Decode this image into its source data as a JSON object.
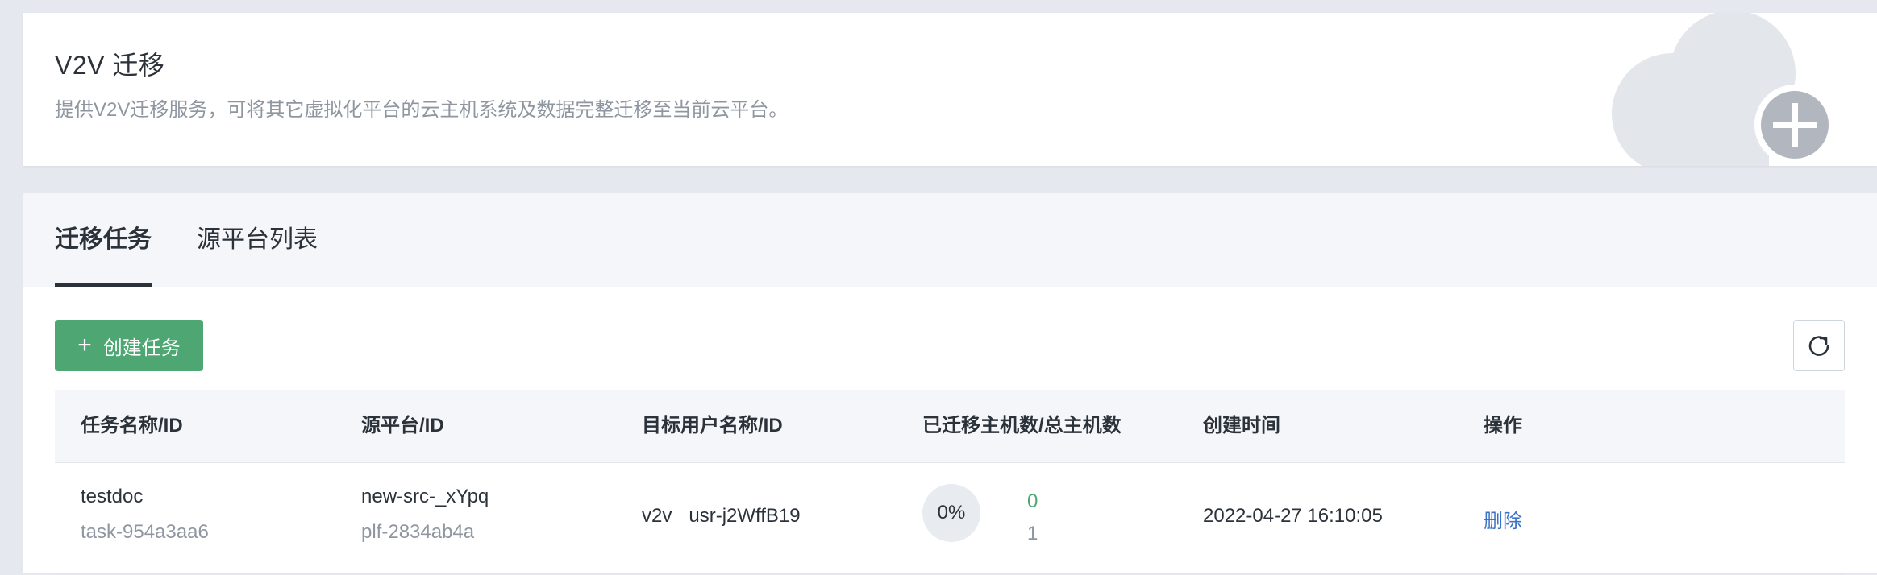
{
  "header": {
    "title": "V2V 迁移",
    "description": "提供V2V迁移服务，可将其它虚拟化平台的云主机系统及数据完整迁移至当前云平台。",
    "illustration_icon": "cloud-plus-icon"
  },
  "tabs": [
    {
      "label": "迁移任务",
      "active": true
    },
    {
      "label": "源平台列表",
      "active": false
    }
  ],
  "toolbar": {
    "create_label": "创建任务",
    "create_icon": "plus-icon",
    "refresh_icon": "refresh-icon",
    "accent_color": "#4ea773"
  },
  "table": {
    "columns": [
      "任务名称/ID",
      "源平台/ID",
      "目标用户名称/ID",
      "已迁移主机数/总主机数",
      "创建时间",
      "操作"
    ],
    "rows": [
      {
        "name": "testdoc",
        "id": "task-954a3aa6",
        "source_name": "new-src-_xYpq",
        "source_id": "plf-2834ab4a",
        "target_user": "v2v",
        "target_user_id": "usr-j2WffB19",
        "progress": "0%",
        "migrated": "0",
        "total": "1",
        "created_at": "2022-04-27 16:10:05",
        "action": "删除"
      }
    ]
  }
}
